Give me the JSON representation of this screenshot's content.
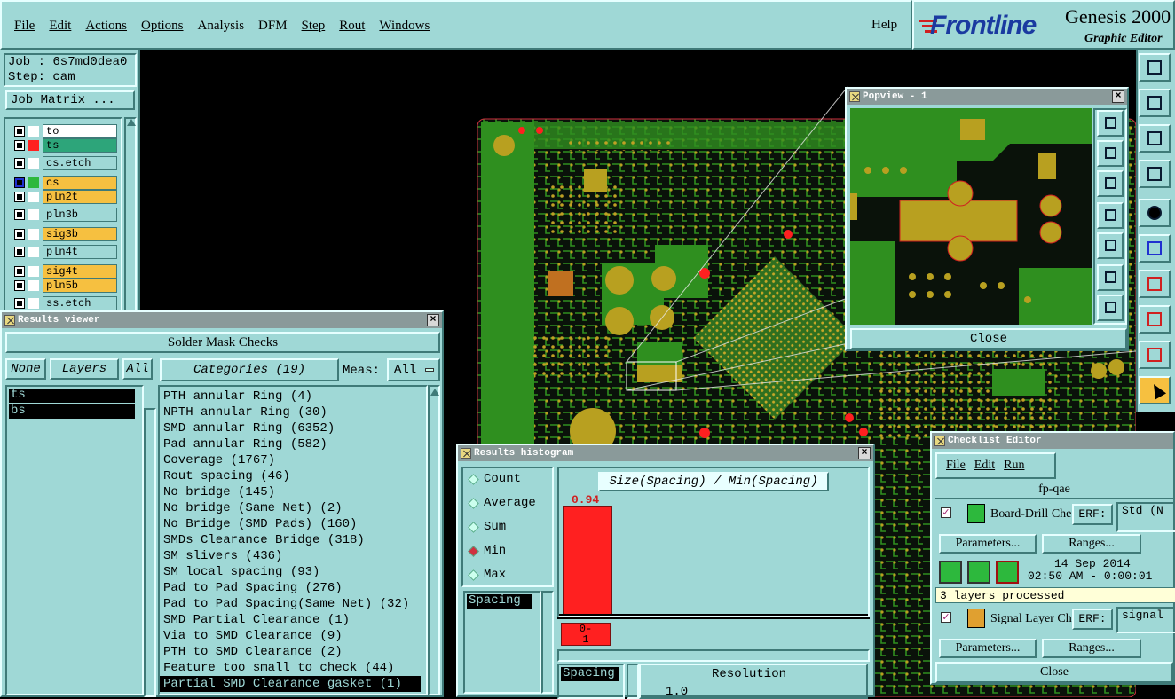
{
  "menubar": {
    "items": [
      "File",
      "Edit",
      "Actions",
      "Options",
      "Analysis",
      "DFM",
      "Step",
      "Rout",
      "Windows"
    ],
    "help": "Help"
  },
  "brand": {
    "logo": "Frontline",
    "product": "Genesis 2000",
    "subtitle": "Graphic Editor"
  },
  "job": {
    "job_label": "Job : 6s7md0dea0",
    "step_label": "Step: cam",
    "matrix_button": "Job Matrix ..."
  },
  "layers": [
    {
      "name": "to",
      "color": "#ffffff",
      "swatch": "#ffffff"
    },
    {
      "name": "ts",
      "color": "#2da57a",
      "swatch": "#ff2020"
    },
    {
      "name": "cs.etch",
      "color": "#9fd8d6",
      "swatch": "#ffffff"
    },
    {
      "name": "cs",
      "color": "#f6c040",
      "swatch": "#2db83d"
    },
    {
      "name": "pln2t",
      "color": "#f6c040",
      "swatch": "#ffffff"
    },
    {
      "name": "pln3b",
      "color": "#9fd8d6",
      "swatch": "#ffffff"
    },
    {
      "name": "sig3b",
      "color": "#f6c040",
      "swatch": "#ffffff"
    },
    {
      "name": "pln4t",
      "color": "#9fd8d6",
      "swatch": "#ffffff"
    },
    {
      "name": "sig4t",
      "color": "#f6c040",
      "swatch": "#ffffff"
    },
    {
      "name": "pln5b",
      "color": "#f6c040",
      "swatch": "#ffffff"
    },
    {
      "name": "ss.etch",
      "color": "#9fd8d6",
      "swatch": "#ffffff"
    }
  ],
  "results_viewer": {
    "title": "Results viewer",
    "heading": "Solder Mask Checks",
    "none_btn": "None",
    "layers_btn": "Layers",
    "all_btn": "All",
    "categories_btn": "Categories (19)",
    "meas_label": "Meas:",
    "meas_value": "All",
    "layer_items": [
      "ts",
      "bs"
    ],
    "categories": [
      "PTH annular Ring (4)",
      "NPTH annular Ring (30)",
      "SMD annular Ring (6352)",
      "Pad annular Ring (582)",
      "Coverage (1767)",
      "Rout spacing (46)",
      "No bridge (145)",
      "No bridge (Same Net) (2)",
      "No Bridge (SMD Pads) (160)",
      "SMDs Clearance Bridge (318)",
      "SM slivers (436)",
      "SM local spacing (93)",
      "Pad to Pad Spacing (276)",
      "Pad to Pad Spacing(Same Net) (32)",
      "SMD Partial Clearance (1)",
      "Via to SMD Clearance (9)",
      "PTH to SMD Clearance (2)",
      "Feature too small to check (44)",
      "Partial SMD Clearance gasket (1)"
    ]
  },
  "histogram": {
    "title": "Results histogram",
    "radios": [
      "Count",
      "Average",
      "Sum",
      "Min",
      "Max"
    ],
    "selected": "Min",
    "list_item": "Spacing",
    "chart_title": "Size(Spacing) / Min(Spacing)",
    "bar_label": "0.94",
    "bin_label_1": "0-",
    "bin_label_2": "1",
    "lower_list_item": "Spacing",
    "resolution_label": "Resolution",
    "resolution_value": "1.0"
  },
  "popview": {
    "title": "Popview - 1",
    "close": "Close"
  },
  "checklist": {
    "title": "Checklist Editor",
    "menu": [
      "File",
      "Edit",
      "Run"
    ],
    "name": "fp-qae",
    "row1_name": "Board-Drill Che",
    "row1_erf_label": "ERF:",
    "row1_erf_value": "Std (N",
    "params": "Parameters...",
    "ranges": "Ranges...",
    "date": "14 Sep 2014",
    "time": "02:50 AM - 0:00:01",
    "status": "3 layers processed",
    "row2_name": "Signal Layer Ch",
    "row2_erf_label": "ERF:",
    "row2_erf_value": "signal",
    "params2": "Parameters...",
    "ranges2": "Ranges...",
    "close": "Close"
  },
  "colors": {
    "panel": "#9fd8d6",
    "selected_layer": "#f6c040",
    "bar": "#ff2020",
    "pcb_green": "#2f8f1f",
    "pcb_copper": "#b8a020"
  }
}
